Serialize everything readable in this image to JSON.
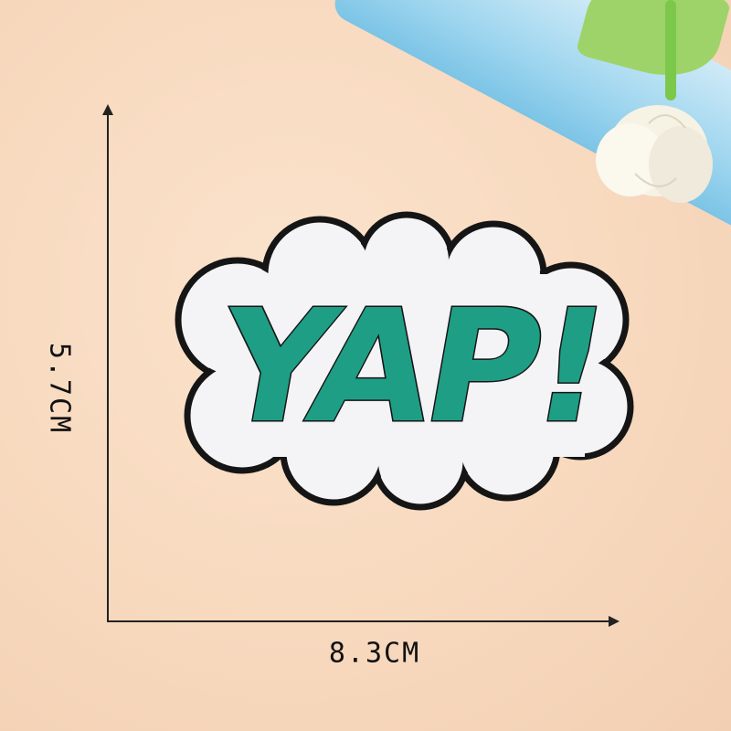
{
  "dimensions": {
    "height_label": "5.7CM",
    "width_label": "8.3CM"
  },
  "patch": {
    "text": "YAP!"
  },
  "colors": {
    "background": "#f9dcc2",
    "letters": "#1f9e86",
    "outline": "#111111",
    "patch_fill": "#f4f4f6",
    "letter_edge": "#f0a8a0",
    "tube": "#9fd6ef"
  }
}
